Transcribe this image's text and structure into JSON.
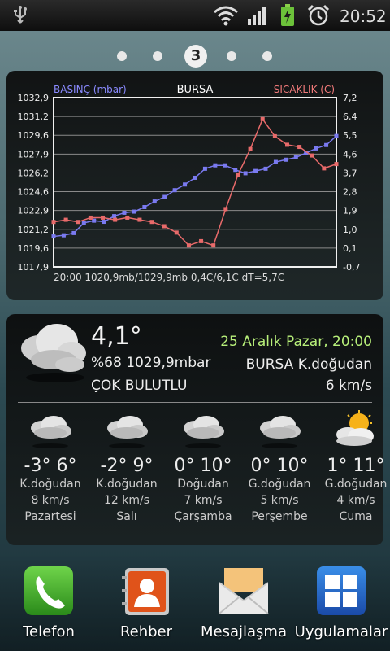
{
  "status_bar": {
    "time": "20:52",
    "icons": [
      "usb-icon",
      "wifi-icon",
      "signal-icon",
      "battery-charging-icon",
      "alarm-icon"
    ]
  },
  "pager": {
    "current": "3",
    "pages_before": 2,
    "pages_after": 2
  },
  "chart_data": {
    "type": "line",
    "title": "BURSA",
    "left_axis_label": "BASINÇ (mbar)",
    "right_axis_label": "SICAKLIK (C)",
    "left_ticks": [
      "1032,9",
      "1031,2",
      "1029,6",
      "1027,9",
      "1026,2",
      "1024,6",
      "1022,9",
      "1021,2",
      "1019,6",
      "1017,9"
    ],
    "right_ticks": [
      "7,2",
      "6,4",
      "5,5",
      "4,6",
      "3,7",
      "2,8",
      "1,9",
      "1,0",
      "0,1",
      "-0,7"
    ],
    "ylim_left": [
      1017.9,
      1032.9
    ],
    "ylim_right": [
      -0.7,
      7.2
    ],
    "series": [
      {
        "name": "BASINÇ (mbar)",
        "axis": "left",
        "color": "#7a7af0",
        "values": [
          1020.6,
          1020.7,
          1020.9,
          1021.8,
          1022.0,
          1021.9,
          1022.4,
          1022.7,
          1022.8,
          1023.2,
          1023.7,
          1024.1,
          1024.7,
          1025.2,
          1025.8,
          1026.6,
          1026.9,
          1026.9,
          1026.5,
          1026.2,
          1026.4,
          1026.6,
          1027.2,
          1027.4,
          1027.6,
          1028.0,
          1028.4,
          1028.7,
          1029.5
        ]
      },
      {
        "name": "SICAKLIK (C)",
        "axis": "right",
        "color": "#e86a6a",
        "values": [
          1.4,
          1.5,
          1.4,
          1.6,
          1.6,
          1.5,
          1.6,
          1.5,
          1.4,
          1.2,
          0.9,
          0.3,
          0.5,
          0.3,
          2.0,
          3.6,
          4.8,
          6.2,
          5.4,
          5.0,
          4.9,
          4.5,
          3.9,
          4.1
        ]
      }
    ],
    "footer": "20:00 1020,9mb/1029,9mb 0,4C/6,1C  dT=5,7C"
  },
  "current": {
    "temperature": "4,1°",
    "humidity_pressure": "%68 1029,9mbar",
    "condition": "ÇOK BULUTLU",
    "date_time": "25 Aralık Pazar, 20:00",
    "location_wind": "BURSA K.doğudan",
    "wind_speed": "6 km/s"
  },
  "forecast": [
    {
      "temps": "-3° 6°",
      "wind_dir": "K.doğudan",
      "wind": "8 km/s",
      "day": "Pazartesi",
      "icon": "cloud-icon"
    },
    {
      "temps": "-2° 9°",
      "wind_dir": "K.doğudan",
      "wind": "12 km/s",
      "day": "Salı",
      "icon": "cloud-icon"
    },
    {
      "temps": "0° 10°",
      "wind_dir": "Doğudan",
      "wind": "7 km/s",
      "day": "Çarşamba",
      "icon": "cloud-icon"
    },
    {
      "temps": "0° 10°",
      "wind_dir": "G.doğudan",
      "wind": "5 km/s",
      "day": "Perşembe",
      "icon": "cloud-icon"
    },
    {
      "temps": "1° 11°",
      "wind_dir": "G.doğudan",
      "wind": "4 km/s",
      "day": "Cuma",
      "icon": "sun-cloud-icon"
    }
  ],
  "dock": [
    {
      "label": "Telefon",
      "icon": "phone-icon"
    },
    {
      "label": "Rehber",
      "icon": "contacts-icon"
    },
    {
      "label": "Mesajlaşma",
      "icon": "messaging-icon"
    },
    {
      "label": "Uygulamalar",
      "icon": "apps-icon"
    }
  ]
}
